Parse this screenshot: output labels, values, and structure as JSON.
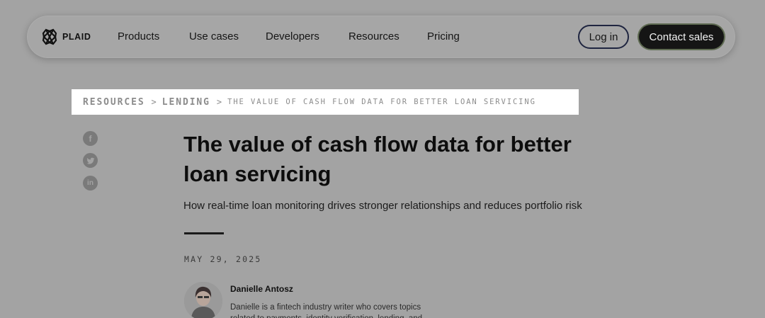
{
  "nav": {
    "logo_text": "PLAID",
    "links": [
      "Products",
      "Use cases",
      "Developers",
      "Resources",
      "Pricing"
    ],
    "login_label": "Log in",
    "contact_label": "Contact sales"
  },
  "breadcrumb": {
    "level1": "RESOURCES",
    "level2": "LENDING",
    "current": "THE VALUE OF CASH FLOW DATA FOR BETTER LOAN SERVICING",
    "separator": ">"
  },
  "social": {
    "facebook": "f",
    "twitter": "twitter-icon",
    "linkedin": "in"
  },
  "article": {
    "title": "The value of cash flow data for better loan servicing",
    "subtitle": "How real-time loan monitoring drives stronger relationships and reduces portfolio risk",
    "date": "MAY 29, 2025",
    "author_name": "Danielle Antosz",
    "author_bio": "Danielle is a fintech industry writer who covers topics related to payments, identity verification, lending, and"
  },
  "colors": {
    "overlay_bg": "#a3a3a3",
    "highlight": "#ffffff",
    "contact_bg": "#151515",
    "text": "#111111"
  }
}
